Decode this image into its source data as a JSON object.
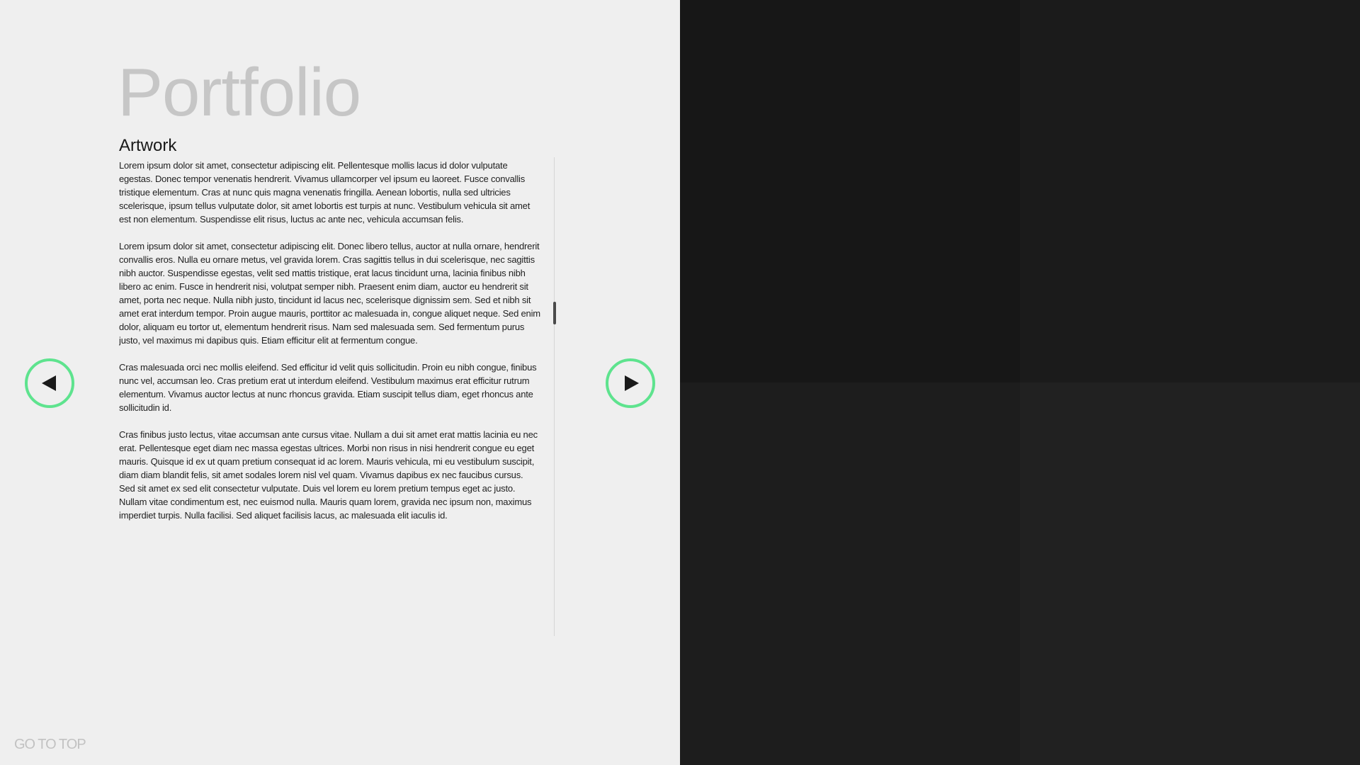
{
  "header": {
    "title": "Portfolio",
    "subtitle": "Artwork"
  },
  "content": {
    "paragraphs": [
      "Lorem ipsum dolor sit amet, consectetur adipiscing elit. Pellentesque mollis lacus id dolor vulputate egestas. Donec tempor venenatis hendrerit. Vivamus ullamcorper vel ipsum eu laoreet. Fusce convallis tristique elementum. Cras at nunc quis magna venenatis fringilla. Aenean lobortis, nulla sed ultricies scelerisque, ipsum tellus vulputate dolor, sit amet lobortis est turpis at nunc. Vestibulum vehicula sit amet est non elementum. Suspendisse elit risus, luctus ac ante nec, vehicula accumsan felis.",
      "Lorem ipsum dolor sit amet, consectetur adipiscing elit. Donec libero tellus, auctor at nulla ornare, hendrerit convallis eros. Nulla eu ornare metus, vel gravida lorem. Cras sagittis tellus in dui scelerisque, nec sagittis nibh auctor. Suspendisse egestas, velit sed mattis tristique, erat lacus tincidunt urna, lacinia finibus nibh libero ac enim. Fusce in hendrerit nisi, volutpat semper nibh. Praesent enim diam, auctor eu hendrerit sit amet, porta nec neque. Nulla nibh justo, tincidunt id lacus nec, scelerisque dignissim sem. Sed et nibh sit amet erat interdum tempor. Proin augue mauris, porttitor ac malesuada in, congue aliquet neque. Sed enim dolor, aliquam eu tortor ut, elementum hendrerit risus. Nam sed malesuada sem. Sed fermentum purus justo, vel maximus mi dapibus quis. Etiam efficitur elit at fermentum congue.",
      "Cras malesuada orci nec mollis eleifend. Sed efficitur id velit quis sollicitudin. Proin eu nibh congue, finibus nunc vel, accumsan leo. Cras pretium erat ut interdum eleifend. Vestibulum maximus erat efficitur rutrum elementum. Vivamus auctor lectus at nunc rhoncus gravida. Etiam suscipit tellus diam, eget rhoncus ante sollicitudin id.",
      "Cras finibus justo lectus, vitae accumsan ante cursus vitae. Nullam a dui sit amet erat mattis lacinia eu nec erat. Pellentesque eget diam nec massa egestas ultrices. Morbi non risus in nisi hendrerit congue eu eget mauris. Quisque id ex ut quam pretium consequat id ac lorem. Mauris vehicula, mi eu vestibulum suscipit, diam diam blandit felis, sit amet sodales lorem nisl vel quam. Vivamus dapibus ex nec faucibus cursus. Sed sit amet ex sed elit consectetur vulputate. Duis vel lorem eu lorem pretium tempus eget ac justo. Nullam vitae condimentum est, nec euismod nulla. Mauris quam lorem, gravida nec ipsum non, maximus imperdiet turpis. Nulla facilisi. Sed aliquet facilisis lacus, ac malesuada elit iaculis id."
    ]
  },
  "navigation": {
    "prev_icon": "triangle-left-icon",
    "next_icon": "triangle-right-icon",
    "button_ring_color": "#5ee38e"
  },
  "footer": {
    "go_to_top_label": "GO TO TOP"
  },
  "colors": {
    "background_left": "#efefef",
    "tiles": [
      "#171717",
      "#1b1b1b",
      "#1d1d1d",
      "#212121"
    ]
  }
}
